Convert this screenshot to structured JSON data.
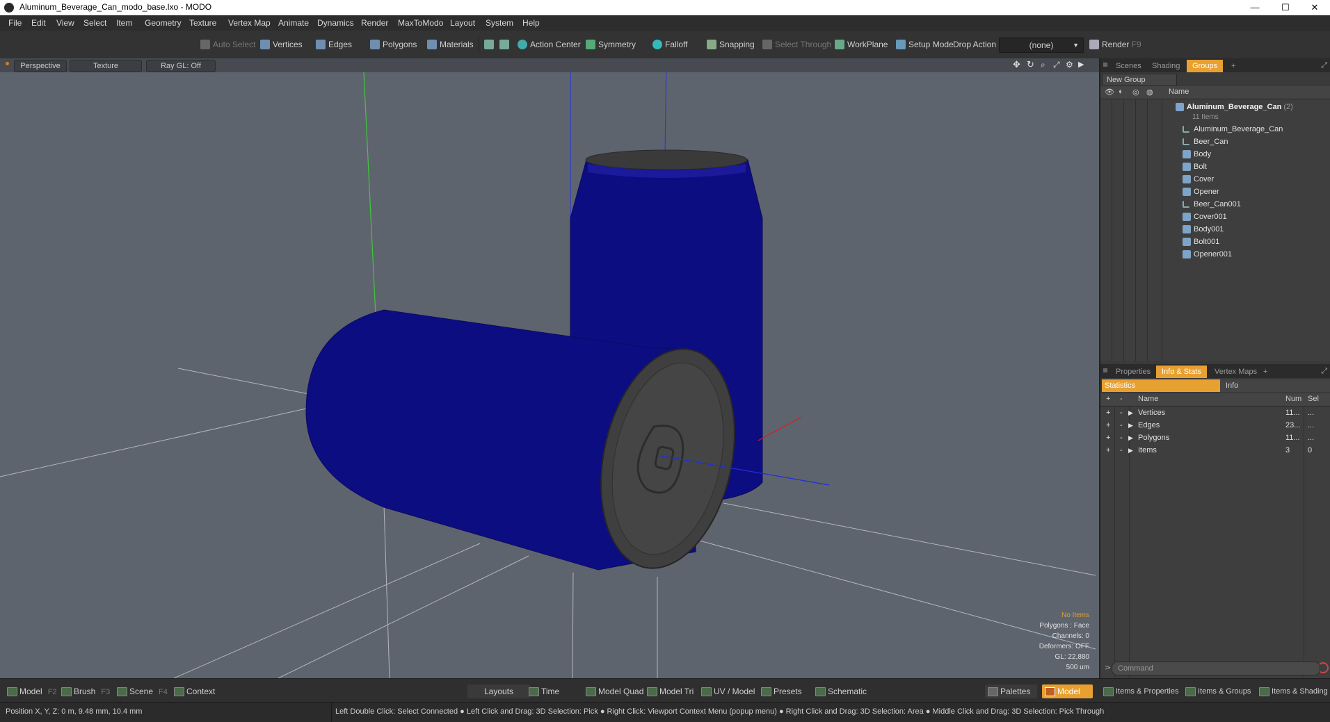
{
  "window": {
    "title": "Aluminum_Beverage_Can_modo_base.lxo - MODO",
    "min": "—",
    "max": "☐",
    "close": "✕"
  },
  "menu": [
    "File",
    "Edit",
    "View",
    "Select",
    "Item",
    "Geometry",
    "Texture",
    "Vertex Map",
    "Animate",
    "Dynamics",
    "Render",
    "MaxToModo",
    "Layout",
    "System",
    "Help"
  ],
  "toolbar": {
    "auto_select": "Auto Select",
    "vertices": "Vertices",
    "edges": "Edges",
    "polygons": "Polygons",
    "materials": "Materials",
    "action_center": "Action Center",
    "symmetry": "Symmetry",
    "falloff": "Falloff",
    "snapping": "Snapping",
    "select_through": "Select Through",
    "workplane": "WorkPlane",
    "setup_mode": "Setup Mode",
    "drop_action_label": "Drop Action",
    "drop_action_value": "(none)",
    "render": "Render",
    "render_key": "F9"
  },
  "viewport": {
    "view": "Perspective",
    "shading": "Texture",
    "raygl": "Ray GL: Off",
    "info": {
      "items": "No Items",
      "polygons": "Polygons : Face",
      "channels": "Channels: 0",
      "deformers": "Deformers: OFF",
      "gl": "GL: 22,880",
      "scale": "500 um"
    }
  },
  "scene_panel": {
    "tabs": [
      "Scenes",
      "Shading",
      "Groups"
    ],
    "active_tab": "Groups",
    "plus": "+",
    "new_group": "New Group",
    "name_header": "Name",
    "root": {
      "name": "Aluminum_Beverage_Can",
      "count": "(2)",
      "sub": "11 Items"
    },
    "items": [
      {
        "name": "Aluminum_Beverage_Can",
        "type": "locator"
      },
      {
        "name": "Beer_Can",
        "type": "locator"
      },
      {
        "name": "Body",
        "type": "mesh"
      },
      {
        "name": "Bolt",
        "type": "mesh"
      },
      {
        "name": "Cover",
        "type": "mesh"
      },
      {
        "name": "Opener",
        "type": "mesh"
      },
      {
        "name": "Beer_Can001",
        "type": "locator"
      },
      {
        "name": "Cover001",
        "type": "mesh"
      },
      {
        "name": "Body001",
        "type": "mesh"
      },
      {
        "name": "Bolt001",
        "type": "mesh"
      },
      {
        "name": "Opener001",
        "type": "mesh"
      }
    ]
  },
  "props_panel": {
    "tabs": [
      "Properties",
      "Info & Stats",
      "Vertex Maps"
    ],
    "active_tab": "Info & Stats",
    "plus": "+",
    "sub_tabs": [
      "Statistics",
      "Info"
    ],
    "headers": {
      "plus": "+",
      "minus": "-",
      "name": "Name",
      "num": "Num",
      "sel": "Sel"
    },
    "rows": [
      {
        "name": "Vertices",
        "num": "11...",
        "sel": "..."
      },
      {
        "name": "Edges",
        "num": "23...",
        "sel": "..."
      },
      {
        "name": "Polygons",
        "num": "11...",
        "sel": "..."
      },
      {
        "name": "Items",
        "num": "3",
        "sel": "0"
      }
    ]
  },
  "command": {
    "placeholder": "Command",
    "arrow": ">"
  },
  "bottom_left": [
    {
      "label": "Model",
      "key": "F2"
    },
    {
      "label": "Brush",
      "key": "F3"
    },
    {
      "label": "Scene",
      "key": "F4"
    },
    {
      "label": "Context",
      "key": ""
    }
  ],
  "bottom_mid": [
    "Layouts",
    "Time",
    "Model Quad",
    "Model Tri",
    "UV / Model",
    "Presets",
    "Schematic"
  ],
  "bottom_right": {
    "palettes": "Palettes",
    "model": "Model",
    "items_properties": "Items & Properties",
    "items_groups": "Items & Groups",
    "items_shading": "Items & Shading"
  },
  "status": {
    "position": "Position X, Y, Z:   0 m, 9.48 mm, 10.4 mm",
    "hints": "Left Double Click: Select Connected ● Left Click and Drag: 3D Selection: Pick ● Right Click: Viewport Context Menu (popup menu) ● Right Click and Drag: 3D Selection: Area ● Middle Click and Drag: 3D Selection: Pick Through"
  }
}
